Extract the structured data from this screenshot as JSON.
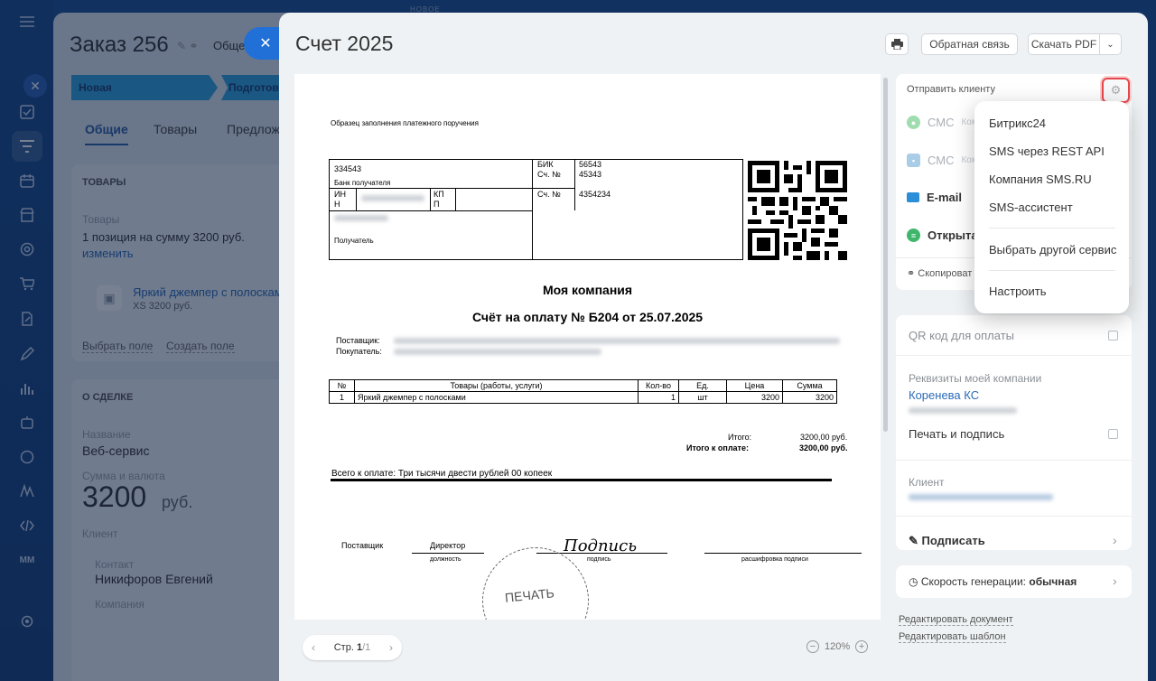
{
  "background_order": {
    "title": "Заказ 256",
    "tab_general_short": "Общее",
    "stages": [
      "Новая",
      "Подготовк"
    ],
    "tabs": [
      "Общие",
      "Товары",
      "Предлож"
    ],
    "goods_section": "ТОВАРЫ",
    "goods_label": "Товары",
    "goods_summary": "1 позиция на сумму 3200 руб.",
    "change_link": "изменить",
    "product_name": "Яркий джемпер с полосками",
    "product_meta": "XS  3200 руб.",
    "select_field": "Выбрать поле",
    "create_field": "Создать поле",
    "deal_section": "О СДЕЛКЕ",
    "name_label": "Название",
    "name_value": "Веб-сервис",
    "sum_label": "Сумма и валюта",
    "sum_value": "3200",
    "sum_currency": "руб.",
    "client_label": "Клиент",
    "contact_label": "Контакт",
    "contact_name": "Никифоров Евгений",
    "company_label": "Компания",
    "new_label": "НОВОЕ"
  },
  "slider": {
    "title": "Счет 2025",
    "feedback": "Обратная связь",
    "download_pdf": "Скачать PDF"
  },
  "document": {
    "sample_title": "Образец заполнения платежного поручения",
    "bank_account": "334543",
    "bank_receiver": "Банк получателя",
    "inn": "ИН\nН",
    "kpp": "КП\nП",
    "receiver": "Получатель",
    "bik_label": "БИК",
    "bik_value": "56543",
    "acc_label": "Сч. №",
    "acc_value": "45343",
    "acc2_label": "Сч. №",
    "acc2_value": "4354234",
    "company": "Моя компания",
    "heading": "Счёт на оплату № Б204 от 25.07.2025",
    "supplier_label": "Поставщик:",
    "buyer_label": "Покупатель:",
    "table_headers": [
      "№",
      "Товары (работы, услуги)",
      "Кол-во",
      "Ед.",
      "Цена",
      "Сумма"
    ],
    "table_rows": [
      [
        "1",
        "Яркий джемпер с полосками",
        "1",
        "шт",
        "3200",
        "3200"
      ]
    ],
    "total_label": "Итого:",
    "total_value": "3200,00 руб.",
    "to_pay_label": "Итого к оплате:",
    "to_pay_value": "3200,00 руб.",
    "in_words": "Всего к оплате: Три тысячи двести рублей 00 копеек",
    "sign_supplier": "Поставщик",
    "sign_position": "Директор",
    "sign_position_caption": "должность",
    "sign_signature": "Подпись",
    "sign_signature_caption": "подпись",
    "sign_decode_caption": "расшифровка подписи",
    "stamp": "ПЕЧАТЬ"
  },
  "pager": {
    "label": "Стр. ",
    "current": "1",
    "total": "/1"
  },
  "zoom": "120%",
  "send": {
    "label": "Отправить клиенту",
    "channels": [
      {
        "name": "СМС",
        "sub": "Ком"
      },
      {
        "name": "СМС",
        "sub": "Ком"
      },
      {
        "name": "E-mail",
        "sub": ""
      },
      {
        "name": "Открыта",
        "sub": ""
      }
    ],
    "copy_link": "Скопироват"
  },
  "menu": {
    "items": [
      "Битрикс24",
      "SMS через REST API",
      "Компания SMS.RU",
      "SMS-ассистент"
    ],
    "other": "Выбрать другой сервис",
    "configure": "Настроить"
  },
  "settings": {
    "qr": "QR код для оплаты",
    "my_company_label": "Реквизиты моей компании",
    "my_company": "Коренева КС",
    "print_sign": "Печать и подпись",
    "client_label": "Клиент",
    "sign": "Подписать"
  },
  "generation": {
    "label": "Скорость генерации: ",
    "value": "обычная"
  },
  "links": {
    "edit_document": "Редактировать документ",
    "edit_template": "Редактировать шаблон"
  }
}
